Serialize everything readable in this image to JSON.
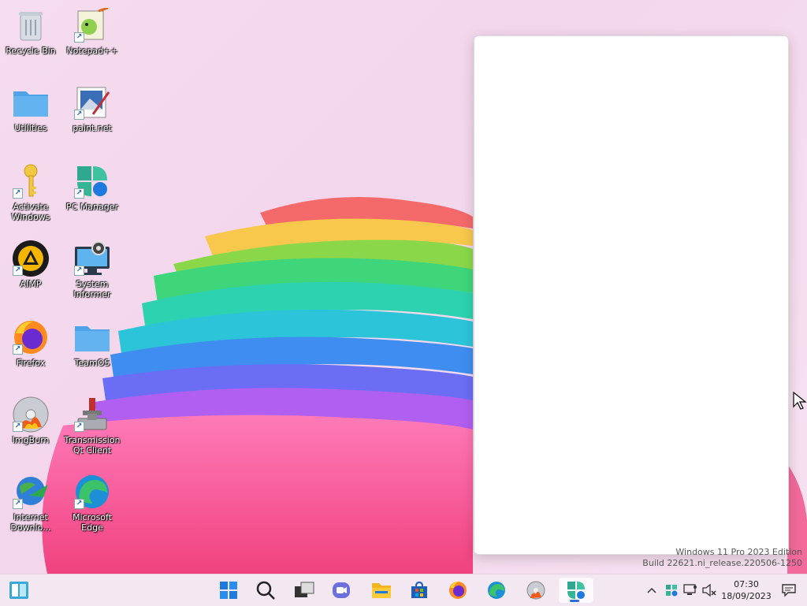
{
  "desktop": {
    "icons": [
      {
        "label": "Recycle Bin",
        "icon": "recycle-bin-icon",
        "shortcut": false
      },
      {
        "label": "Notepad++",
        "icon": "notepad-plus-plus-icon",
        "shortcut": true
      },
      {
        "label": "Utilities",
        "icon": "folder-icon",
        "shortcut": false
      },
      {
        "label": "paint.net",
        "icon": "paint-net-icon",
        "shortcut": true
      },
      {
        "label": "Activate Windows",
        "icon": "key-icon",
        "shortcut": true
      },
      {
        "label": "PC Manager",
        "icon": "pc-manager-icon",
        "shortcut": true
      },
      {
        "label": "AIMP",
        "icon": "aimp-icon",
        "shortcut": true
      },
      {
        "label": "System Informer",
        "icon": "system-informer-icon",
        "shortcut": true
      },
      {
        "label": "Firefox",
        "icon": "firefox-icon",
        "shortcut": true
      },
      {
        "label": "TeamOS",
        "icon": "folder-icon",
        "shortcut": false
      },
      {
        "label": "ImgBurn",
        "icon": "imgburn-icon",
        "shortcut": true
      },
      {
        "label": "Transmission Qt Client",
        "icon": "transmission-icon",
        "shortcut": true
      },
      {
        "label": "Internet Downlo...",
        "icon": "internet-download-manager-icon",
        "shortcut": true
      },
      {
        "label": "Microsoft Edge",
        "icon": "edge-icon",
        "shortcut": true
      }
    ]
  },
  "watermark": {
    "line1": "Windows 11 Pro 2023 Edition",
    "line2": "Build 22621.ni_release.220506-1250"
  },
  "taskbar": {
    "widgets": "widgets-icon",
    "pinned": [
      "start-icon",
      "search-icon",
      "task-view-icon",
      "teams-chat-icon",
      "file-explorer-icon",
      "microsoft-store-icon",
      "firefox-icon",
      "edge-icon",
      "imgburn-icon",
      "pc-manager-icon"
    ],
    "active": "pc-manager-icon",
    "tray": [
      "chevron-up-icon",
      "pc-manager-tray-icon",
      "network-icon",
      "volume-muted-icon"
    ],
    "clock": {
      "time": "07:30",
      "date": "18/09/2023"
    },
    "notifications": "notification-icon"
  },
  "colors": {
    "accent": "#2b6fd6",
    "folder": "#4fa3e8",
    "panel": "#ffffff"
  }
}
